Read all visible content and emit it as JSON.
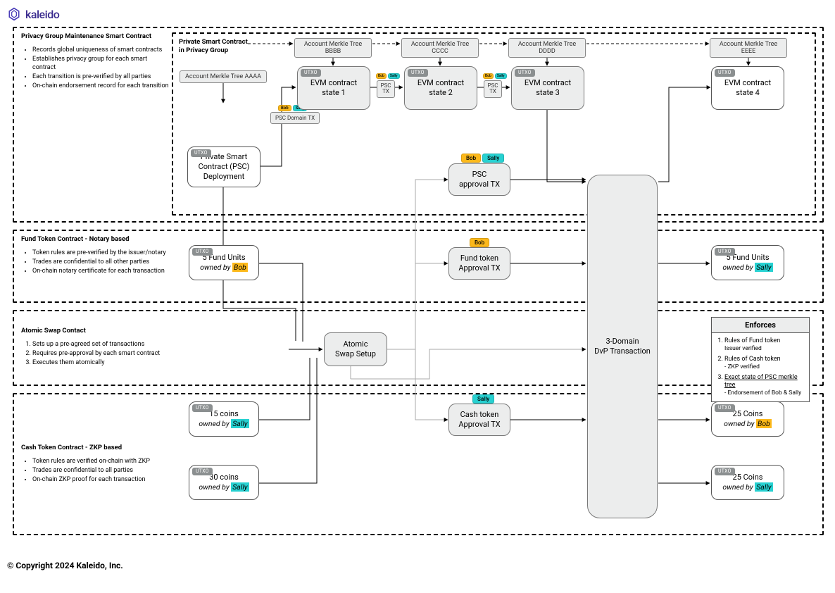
{
  "logo": {
    "text": "kaleido"
  },
  "section1": {
    "title": "Privacy Group Maintenance Smart Contract",
    "bullets": [
      "Records global uniqueness of smart contracts",
      "Establishes privacy group for each smart contract",
      "Each transition is pre-verified by all parties",
      "On-chain endorsement record for each transition"
    ],
    "inner_title1": "Private Smart Contract",
    "inner_title2": "in Privacy Group"
  },
  "section2": {
    "title": "Fund Token Contract - Notary based",
    "bullets": [
      "Token rules are pre-verified by the issuer/notary",
      "Trades are confidential to all other parties",
      "On-chain notary certificate for each transaction"
    ]
  },
  "section3": {
    "title": "Atomic Swap Contact",
    "items": [
      "Sets up a pre-agreed set of transactions",
      "Requires pre-approval by each smart contract",
      "Executes them atomically"
    ]
  },
  "section4": {
    "title": "Cash Token Contract - ZKP based",
    "bullets": [
      "Token rules are verified on-chain with ZKP",
      "Trades are confidential to all parties",
      "On-chain ZKP proof for each transaction"
    ]
  },
  "merkle": {
    "a": "Account Merkle Tree AAAA",
    "b": "Account Merkle Tree BBBB",
    "c": "Account Merkle Tree CCCC",
    "d": "Account Merkle Tree DDDD",
    "e": "Account Merkle Tree EEEE"
  },
  "nodes": {
    "deploy1": "Private Smart",
    "deploy2": "Contract (PSC)",
    "deploy3": "Deployment",
    "state1a": "EVM contract",
    "state1b": "state 1",
    "state2a": "EVM contract",
    "state2b": "state 2",
    "state3a": "EVM contract",
    "state3b": "state 3",
    "state4a": "EVM contract",
    "state4b": "state 4",
    "psc_domain": "PSC Domain TX",
    "psc_tx": "PSC\nTX",
    "psc_appr1": "PSC",
    "psc_appr2": "approval TX",
    "fund5a": "5 Fund Units",
    "fund5b_prefix": "owned by ",
    "fund5b_bob": "Bob",
    "fund_appr1": "Fund token",
    "fund_appr2": "Approval TX",
    "fund5out1": "5 Fund Units",
    "fund5out2_sally": "Sally",
    "atomic1": "Atomic",
    "atomic2": "Swap Setup",
    "dvp1": "3-Domain",
    "dvp2": "DvP Transaction",
    "cash_appr1": "Cash token",
    "cash_appr2": "Approval TX",
    "coins15a": "15 coins",
    "coins15b_sally": "Sally",
    "coins30a": "30 coins",
    "coins30b_sally": "Sally",
    "coins25boba": "25 Coins",
    "coins25bobb": "Bob",
    "coins25sallya": "25 Coins",
    "coins25sallyb": "Sally",
    "utxo": "UTXO"
  },
  "chips": {
    "bob": "Bob",
    "sally": "Sally"
  },
  "enforces": {
    "title": "Enforces",
    "items": [
      {
        "t": "Rules of Fund token",
        "s": "Issuer verified"
      },
      {
        "t": "Rules of Cash token",
        "s": "- ZKP verified"
      },
      {
        "t": "Exact state of PSC merkle tree",
        "s": "- Endorsement of Bob & Sally",
        "u": true
      }
    ]
  },
  "copyright": "© Copyright 2024 Kaleido, Inc."
}
